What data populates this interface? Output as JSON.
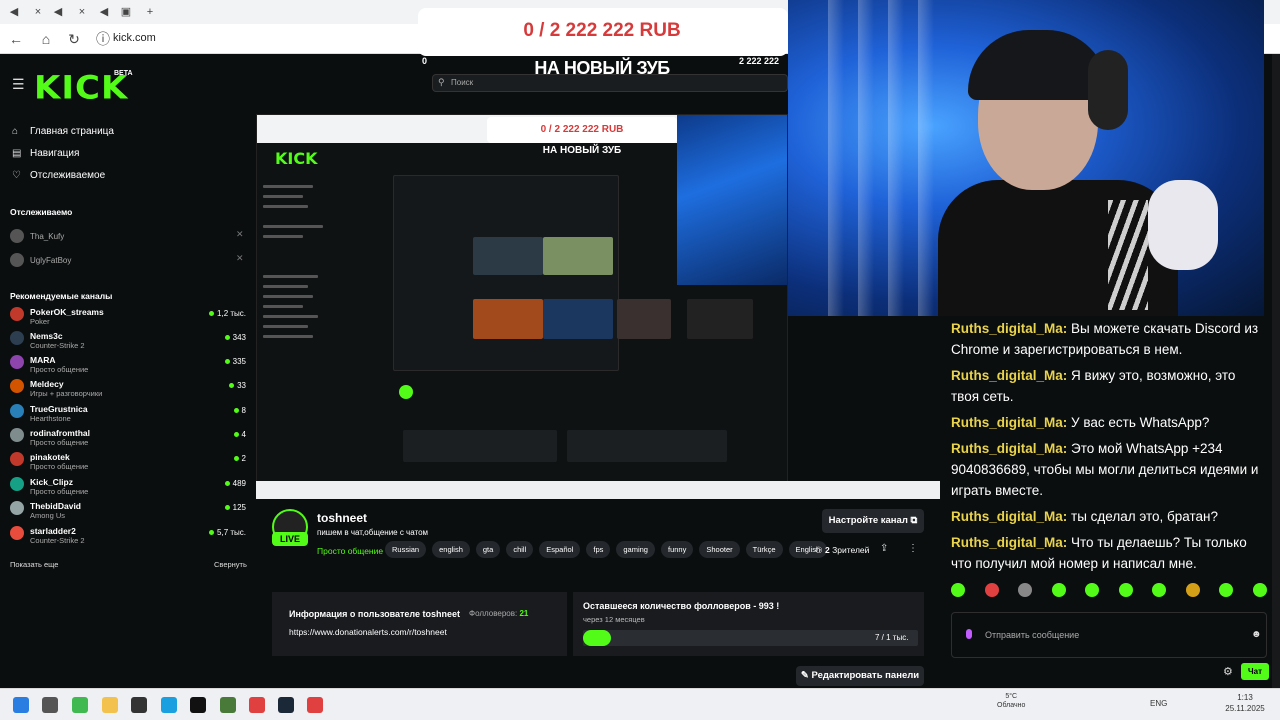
{
  "browser": {
    "url": "kick.com"
  },
  "donation": {
    "progress_text": "0 / 2 222 222 RUB",
    "goal_title": "НА НОВЫЙ ЗУБ",
    "min_label": "0",
    "max_label": "2 222 222",
    "progress": 0
  },
  "sidebar": {
    "logo": "KICK",
    "beta": "BETA",
    "nav": [
      {
        "label": "Главная страница",
        "icon": "home-icon"
      },
      {
        "label": "Навигация",
        "icon": "compass-icon"
      },
      {
        "label": "Отслеживаемое",
        "icon": "heart-icon"
      }
    ],
    "following_title": "Отслеживаемо",
    "following": [
      {
        "name": "Tha_Kufy"
      },
      {
        "name": "UglyFatBoy"
      }
    ],
    "recommended_title": "Рекомендуемые каналы",
    "channels": [
      {
        "name": "PokerOK_streams",
        "category": "Poker",
        "viewers": "1,2 тыс."
      },
      {
        "name": "Nems3c",
        "category": "Counter-Strike 2",
        "viewers": "343"
      },
      {
        "name": "MARA",
        "category": "Просто общение",
        "viewers": "335"
      },
      {
        "name": "Meldecy",
        "category": "Игры + разговорчики",
        "viewers": "33"
      },
      {
        "name": "TrueGrustnica",
        "category": "Hearthstone",
        "viewers": "8"
      },
      {
        "name": "rodinafromthal",
        "category": "Просто общение",
        "viewers": "4"
      },
      {
        "name": "pinakotek",
        "category": "Просто общение",
        "viewers": "2"
      },
      {
        "name": "Kick_Clipz",
        "category": "Просто общение",
        "viewers": "489"
      },
      {
        "name": "ThebidDavid",
        "category": "Among Us",
        "viewers": "125"
      },
      {
        "name": "starladder2",
        "category": "Counter-Strike 2",
        "viewers": "5,7 тыс."
      }
    ],
    "show_more": "Показать еще",
    "collapse": "Свернуть",
    "avatar_colors": [
      "#c0392b",
      "#2c3e50",
      "#8e44ad",
      "#d35400",
      "#2980b9",
      "#7f8c8d",
      "#c0392b",
      "#16a085",
      "#95a5a6",
      "#e74c3c"
    ]
  },
  "search": {
    "placeholder": "Поиск"
  },
  "stream": {
    "channel": "toshneet",
    "title": "пишем в чат,общение с чатом",
    "category": "Просто общение",
    "tags": [
      "Russian",
      "english",
      "gta",
      "chill",
      "Español",
      "fps",
      "gaming",
      "funny",
      "Shooter",
      "Türkçe",
      "English"
    ],
    "settings_button": "Настройте канал",
    "viewers": "2",
    "viewers_label": "Зрителей",
    "live": "LIVE"
  },
  "panels": {
    "info_title": "Информация о пользователе toshneet",
    "followers_label": "Фолловеров:",
    "followers": "21",
    "donation_url": "https://www.donationalerts.com/r/toshneet",
    "remaining_title": "Оставшееся количество фолловеров - 993 !",
    "remaining_sub": "через 12 месяцев",
    "remaining_value": "7 / 1 тыс.",
    "remaining_progress": 0.007,
    "edit_button": "Редактировать панели"
  },
  "chat": {
    "messages": [
      {
        "user": "Ruths_digital_Ma:",
        "text": "Вы можете скачать Discord из Chrome и зарегистрироваться в нем."
      },
      {
        "user": "Ruths_digital_Ma:",
        "text": "Я вижу это, возможно, это твоя сеть."
      },
      {
        "user": "Ruths_digital_Ma:",
        "text": "У вас есть WhatsApp?"
      },
      {
        "user": "Ruths_digital_Ma:",
        "text": "Это мой WhatsApp +234 9040836689, чтобы мы могли делиться идеями и играть вместе."
      },
      {
        "user": "Ruths_digital_Ma:",
        "text": "ты сделал это, братан?"
      },
      {
        "user": "Ruths_digital_Ma:",
        "text": "Что ты делаешь? Ты только что получил мой номер и написал мне."
      }
    ],
    "input_placeholder": "Отправить сообщение",
    "send_button": "Чат",
    "emote_colors": [
      "#53fc18",
      "#e04040",
      "#888888",
      "#53fc18",
      "#53fc18",
      "#53fc18",
      "#53fc18",
      "#d4a017",
      "#53fc18",
      "#53fc18"
    ]
  },
  "taskbar": {
    "weather_temp": "5°C",
    "weather_text": "Облачно",
    "lang": "ENG",
    "time": "1:13",
    "date": "25.11.2025"
  },
  "colors": {
    "brand": "#53fc18",
    "username": "#e9d34d",
    "donation": "#d63a3a"
  }
}
